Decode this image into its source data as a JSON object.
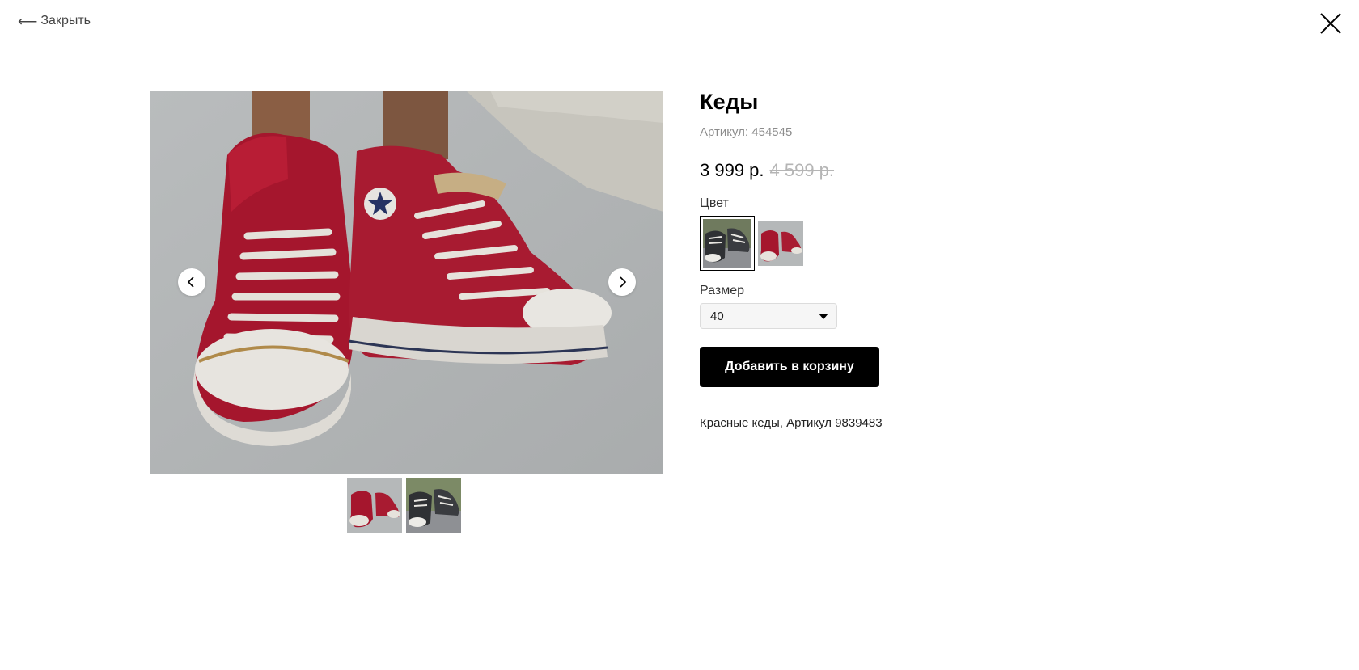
{
  "top": {
    "back_label": "Закрыть",
    "back_icon": "left-arrow-icon",
    "close_icon": "close-x-icon"
  },
  "gallery": {
    "main_image": "red high-top sneakers on concrete",
    "prev_icon": "chevron-left-icon",
    "next_icon": "chevron-right-icon",
    "thumbnails": [
      {
        "image": "red high-top sneakers",
        "active": true
      },
      {
        "image": "black high-top sneakers",
        "active": false
      }
    ]
  },
  "product": {
    "title": "Кеды",
    "sku": "Артикул: 454545",
    "price": "3 999 р.",
    "old_price": "4 599 р.",
    "color_label": "Цвет",
    "colors": [
      {
        "image": "black sneakers swatch",
        "selected": true
      },
      {
        "image": "red sneakers swatch",
        "selected": false
      }
    ],
    "size_label": "Размер",
    "size_selected": "40",
    "add_to_cart": "Добавить в корзину",
    "description": "Красные кеды, Артикул 9839483"
  },
  "colors": {
    "accent": "#000000",
    "old_price": "#b5b5b5",
    "muted_text": "#8c8c8c"
  }
}
